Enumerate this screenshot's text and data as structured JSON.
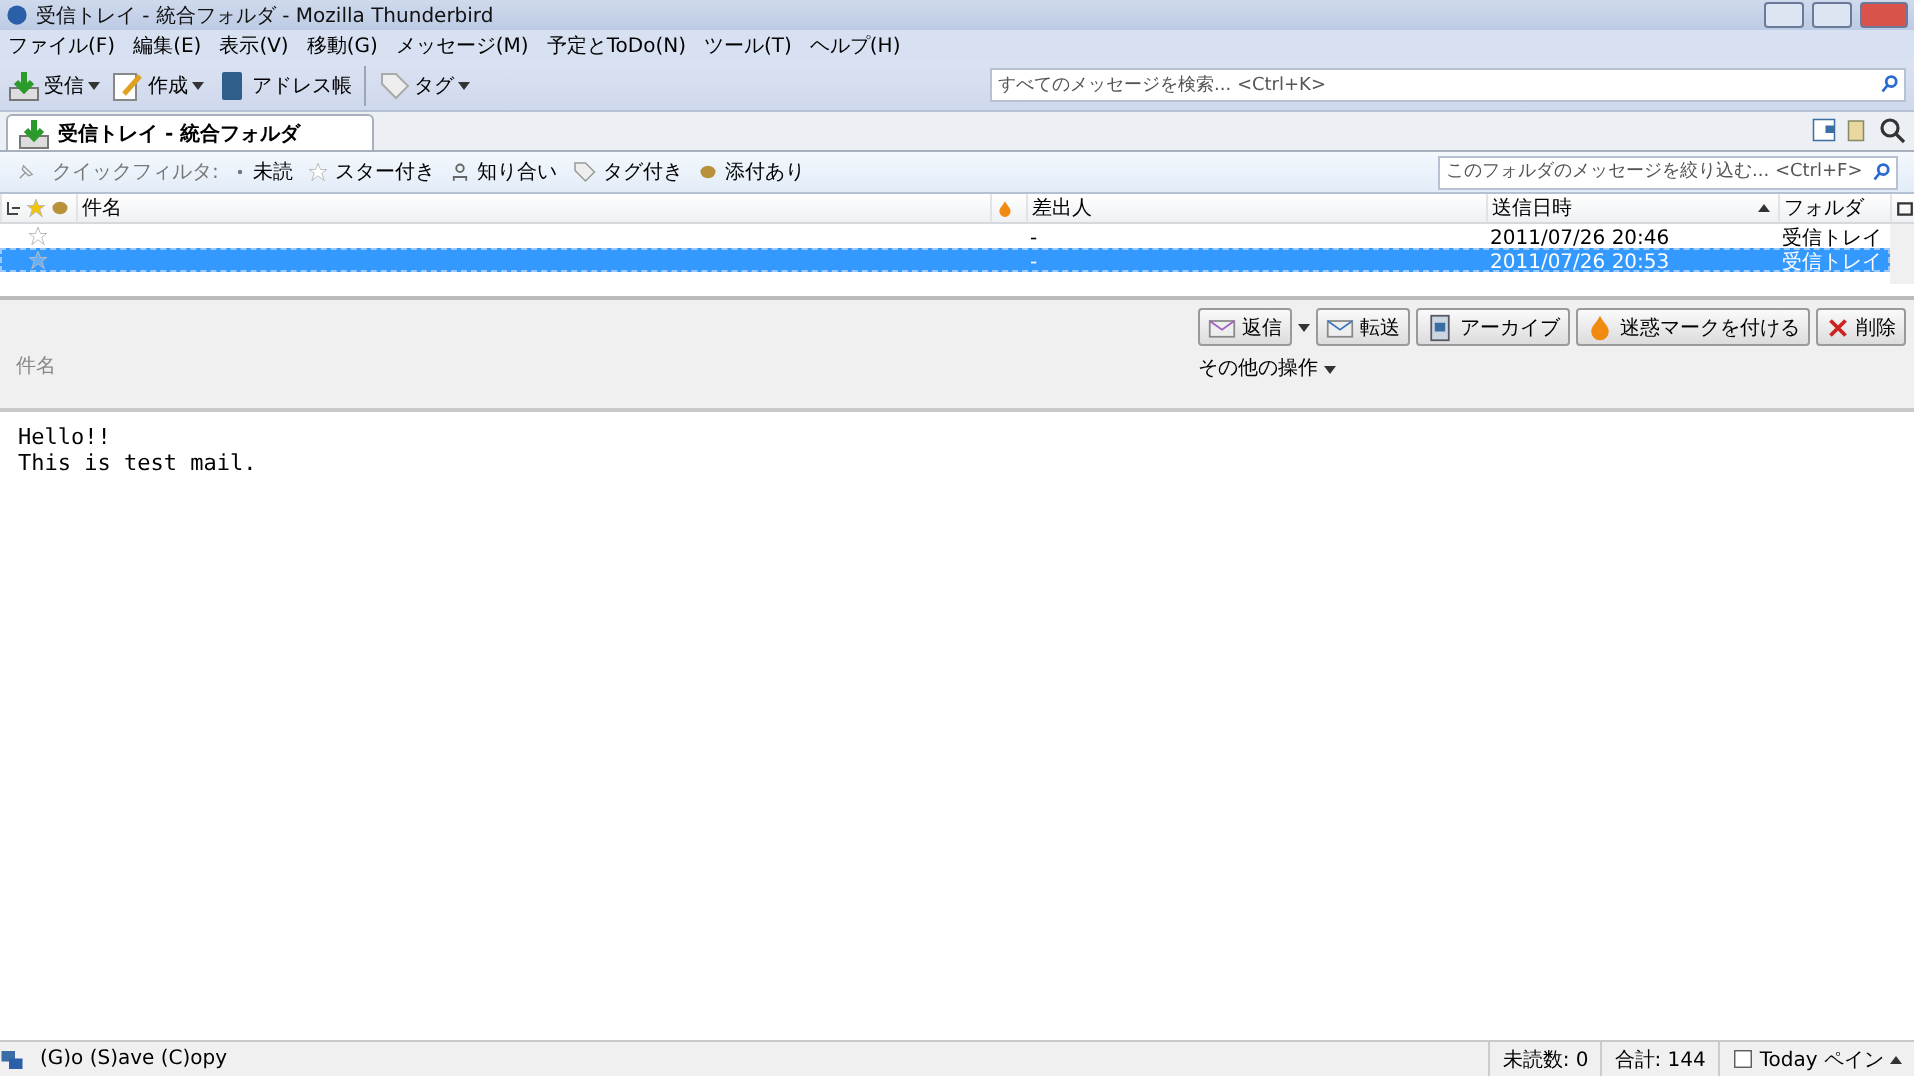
{
  "window": {
    "title": "受信トレイ - 統合フォルダ - Mozilla Thunderbird"
  },
  "menu": [
    "ファイル(F)",
    "編集(E)",
    "表示(V)",
    "移動(G)",
    "メッセージ(M)",
    "予定とToDo(N)",
    "ツール(T)",
    "ヘルプ(H)"
  ],
  "toolbar": [
    {
      "label": "受信",
      "kind": "get",
      "dropdown": true
    },
    {
      "label": "作成",
      "kind": "write",
      "dropdown": true
    },
    {
      "label": "アドレス帳",
      "kind": "book",
      "dropdown": false
    },
    {
      "label": "タグ",
      "kind": "tag",
      "dropdown": true
    }
  ],
  "search": {
    "placeholder": "すべてのメッセージを検索... <Ctrl+K>"
  },
  "tabs": [
    {
      "label": "受信トレイ - 統合フォルダ",
      "selected": true
    }
  ],
  "quick_filter": {
    "label": "クイックフィルタ:",
    "filters": [
      {
        "label": "未読",
        "kind": "unread"
      },
      {
        "label": "スター付き",
        "kind": "star"
      },
      {
        "label": "知り合い",
        "kind": "contact"
      },
      {
        "label": "タグ付き",
        "kind": "tag"
      },
      {
        "label": "添付あり",
        "kind": "attach"
      }
    ],
    "placeholder": "このフォルダのメッセージを絞り込む... <Ctrl+F>"
  },
  "columns": {
    "subject": "件名",
    "sender": "差出人",
    "date": "送信日時",
    "folder": "フォルダ"
  },
  "rows": [
    {
      "selected": false,
      "sender": "-",
      "date": "2011/07/26 20:46",
      "folder": "受信トレイ"
    },
    {
      "selected": true,
      "sender": "-",
      "date": "2011/07/26 20:53",
      "folder": "受信トレイ"
    }
  ],
  "actions": [
    {
      "label": "返信",
      "kind": "reply",
      "dropdown": true
    },
    {
      "label": "転送",
      "kind": "forward",
      "dropdown": false
    },
    {
      "label": "アーカイブ",
      "kind": "archive",
      "dropdown": false
    },
    {
      "label": "迷惑マークを付ける",
      "kind": "junk",
      "dropdown": false
    },
    {
      "label": "削除",
      "kind": "delete",
      "dropdown": false
    }
  ],
  "more_actions": "その他の操作",
  "subject_label": "件名",
  "body": [
    "Hello!!",
    "This is test mail."
  ],
  "status_bar": {
    "text": "(G)o (S)ave (C)opy",
    "unread": "未読数: 0",
    "total": "合計: 144",
    "today": "Today ペイン"
  }
}
